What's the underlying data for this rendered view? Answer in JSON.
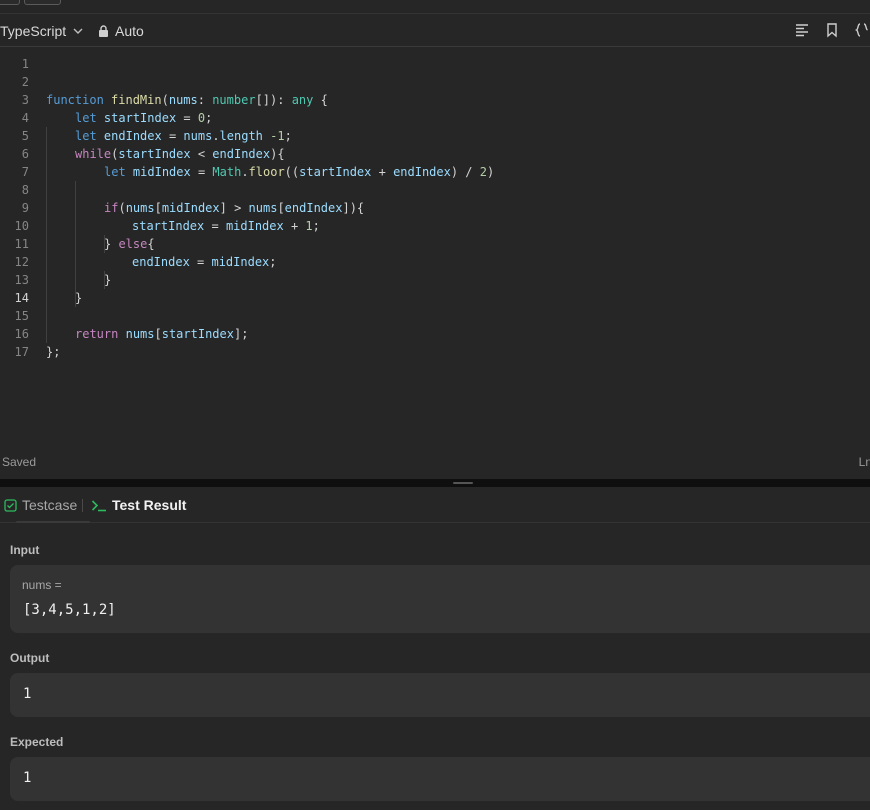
{
  "editor": {
    "language": "TypeScript",
    "mode": "Auto",
    "status": "Saved",
    "right_status": "Ln",
    "active_line": "14",
    "line_numbers": [
      "1",
      "2",
      "3",
      "4",
      "5",
      "6",
      "7",
      "8",
      "9",
      "10",
      "11",
      "12",
      "13",
      "14",
      "15",
      "16",
      "17"
    ]
  },
  "code": {
    "l3": {
      "kw_function": "function",
      "fn_name": "findMin",
      "p_open": "(",
      "param": "nums",
      "colon": ": ",
      "type_number": "number",
      "arr": "[]): ",
      "type_any": "any",
      "brace": " {"
    },
    "l4": {
      "kw": "let",
      "var": "startIndex",
      "op": " = ",
      "num": "0",
      "end": ";"
    },
    "l5": {
      "kw": "let",
      "var": "endIndex",
      "op": " = ",
      "obj": "nums",
      "dot": ".",
      "prop": "length",
      "sp": " ",
      "num": "-1",
      "end": ";"
    },
    "l6": {
      "kw": "while",
      "open": "(",
      "a": "startIndex",
      "op": " < ",
      "b": "endIndex",
      "close": "){"
    },
    "l7": {
      "kw": "let",
      "var": "midIndex",
      "op": " = ",
      "cls": "Math",
      "dot": ".",
      "fn": "floor",
      "open": "((",
      "a": "startIndex",
      "plus": " + ",
      "b": "endIndex",
      "div": ") / ",
      "num": "2",
      "close": ")"
    },
    "l9": {
      "kw": "if",
      "open": "(",
      "a": "nums",
      "b1": "[",
      "b": "midIndex",
      "mid": "] > ",
      "c": "nums",
      "b2": "[",
      "d": "endIndex",
      "close": "]){"
    },
    "l10": {
      "var": "startIndex",
      "op": " = ",
      "b": "midIndex",
      "plus": " + ",
      "num": "1",
      "end": ";"
    },
    "l11": {
      "brace": "} ",
      "kw": "else",
      "open": "{"
    },
    "l12": {
      "var": "endIndex",
      "op": " = ",
      "b": "midIndex",
      "end": ";"
    },
    "l13": {
      "brace": "}"
    },
    "l14": {
      "brace": "}"
    },
    "l16": {
      "kw": "return",
      "sp": " ",
      "a": "nums",
      "open": "[",
      "b": "startIndex",
      "close": "];"
    },
    "l17": {
      "brace": "};"
    }
  },
  "panel": {
    "tab_testcase": "Testcase",
    "tab_result": "Test Result",
    "input_label": "Input",
    "input_var": "nums =",
    "input_value": "[3,4,5,1,2]",
    "output_label": "Output",
    "output_value": "1",
    "expected_label": "Expected",
    "expected_value": "1"
  },
  "colors": {
    "keyword": "#569cd6",
    "control": "#c586c0",
    "function": "#dcdcaa",
    "variable": "#9cdcfe",
    "type": "#4ec9b0",
    "number": "#b5cea8",
    "success_green": "#2cbb5d"
  }
}
